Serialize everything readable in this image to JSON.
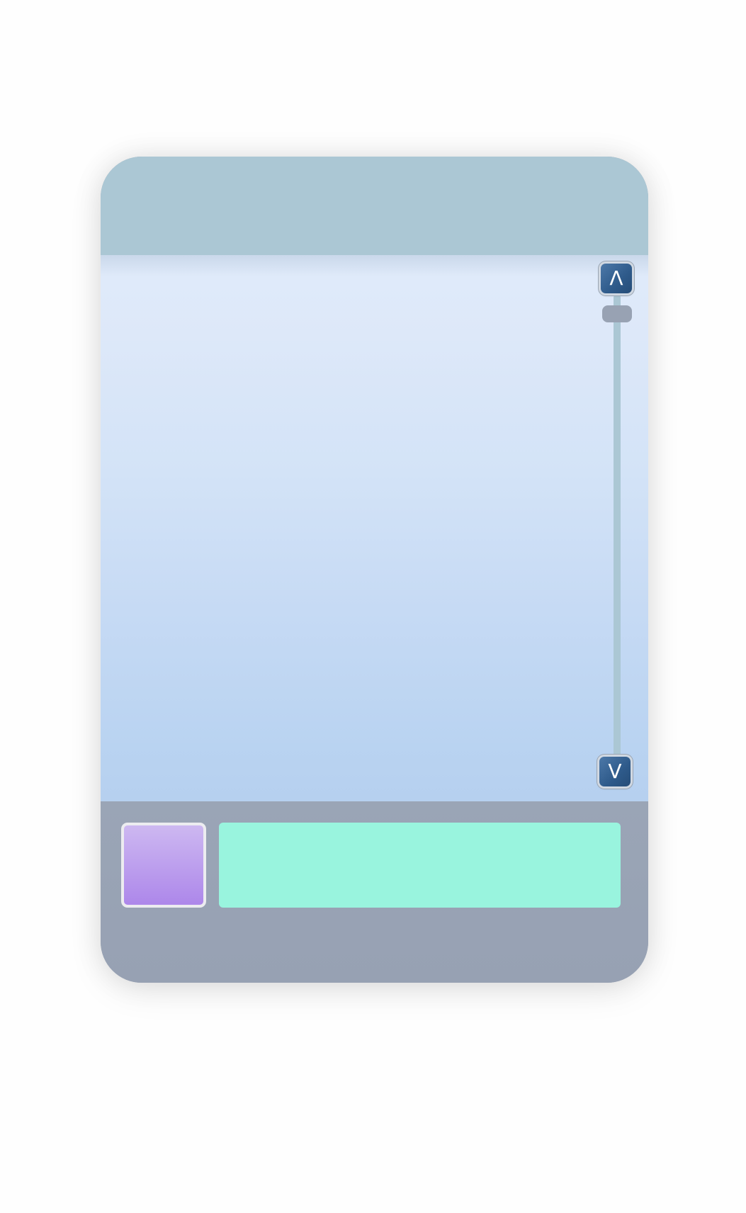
{
  "colors": {
    "page_background": "#fefefe",
    "header": "#abc7d4",
    "content_top": "#e0ebfa",
    "content_bottom": "#b6d0ef",
    "footer": "#98a2b3",
    "scrollbar_track": "#abc7d4",
    "scrollbar_thumb": "#98a2b3",
    "scroll_button": "#2e5a8a",
    "avatar_top": "#cdb8f1",
    "avatar_bottom": "#ad87ea",
    "avatar_border": "#ececf0",
    "input_bar": "#99f4de"
  },
  "scrollbar": {
    "up_button": {
      "glyph": "Λ",
      "icon": "caret-up-icon"
    },
    "down_button": {
      "glyph": "V",
      "icon": "caret-down-icon"
    },
    "position": 0.0
  },
  "composer": {
    "avatar_icon": "avatar",
    "input_value": "",
    "input_placeholder": ""
  }
}
